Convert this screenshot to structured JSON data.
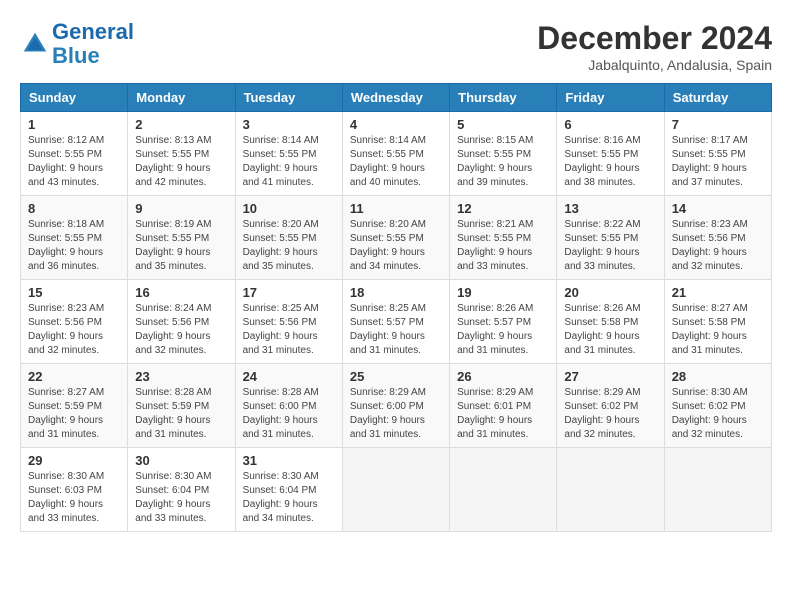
{
  "logo": {
    "line1": "General",
    "line2": "Blue"
  },
  "title": "December 2024",
  "location": "Jabalquinto, Andalusia, Spain",
  "weekdays": [
    "Sunday",
    "Monday",
    "Tuesday",
    "Wednesday",
    "Thursday",
    "Friday",
    "Saturday"
  ],
  "weeks": [
    [
      {
        "day": "1",
        "sunrise": "8:12 AM",
        "sunset": "5:55 PM",
        "daylight": "9 hours and 43 minutes."
      },
      {
        "day": "2",
        "sunrise": "8:13 AM",
        "sunset": "5:55 PM",
        "daylight": "9 hours and 42 minutes."
      },
      {
        "day": "3",
        "sunrise": "8:14 AM",
        "sunset": "5:55 PM",
        "daylight": "9 hours and 41 minutes."
      },
      {
        "day": "4",
        "sunrise": "8:14 AM",
        "sunset": "5:55 PM",
        "daylight": "9 hours and 40 minutes."
      },
      {
        "day": "5",
        "sunrise": "8:15 AM",
        "sunset": "5:55 PM",
        "daylight": "9 hours and 39 minutes."
      },
      {
        "day": "6",
        "sunrise": "8:16 AM",
        "sunset": "5:55 PM",
        "daylight": "9 hours and 38 minutes."
      },
      {
        "day": "7",
        "sunrise": "8:17 AM",
        "sunset": "5:55 PM",
        "daylight": "9 hours and 37 minutes."
      }
    ],
    [
      {
        "day": "8",
        "sunrise": "8:18 AM",
        "sunset": "5:55 PM",
        "daylight": "9 hours and 36 minutes."
      },
      {
        "day": "9",
        "sunrise": "8:19 AM",
        "sunset": "5:55 PM",
        "daylight": "9 hours and 35 minutes."
      },
      {
        "day": "10",
        "sunrise": "8:20 AM",
        "sunset": "5:55 PM",
        "daylight": "9 hours and 35 minutes."
      },
      {
        "day": "11",
        "sunrise": "8:20 AM",
        "sunset": "5:55 PM",
        "daylight": "9 hours and 34 minutes."
      },
      {
        "day": "12",
        "sunrise": "8:21 AM",
        "sunset": "5:55 PM",
        "daylight": "9 hours and 33 minutes."
      },
      {
        "day": "13",
        "sunrise": "8:22 AM",
        "sunset": "5:55 PM",
        "daylight": "9 hours and 33 minutes."
      },
      {
        "day": "14",
        "sunrise": "8:23 AM",
        "sunset": "5:56 PM",
        "daylight": "9 hours and 32 minutes."
      }
    ],
    [
      {
        "day": "15",
        "sunrise": "8:23 AM",
        "sunset": "5:56 PM",
        "daylight": "9 hours and 32 minutes."
      },
      {
        "day": "16",
        "sunrise": "8:24 AM",
        "sunset": "5:56 PM",
        "daylight": "9 hours and 32 minutes."
      },
      {
        "day": "17",
        "sunrise": "8:25 AM",
        "sunset": "5:56 PM",
        "daylight": "9 hours and 31 minutes."
      },
      {
        "day": "18",
        "sunrise": "8:25 AM",
        "sunset": "5:57 PM",
        "daylight": "9 hours and 31 minutes."
      },
      {
        "day": "19",
        "sunrise": "8:26 AM",
        "sunset": "5:57 PM",
        "daylight": "9 hours and 31 minutes."
      },
      {
        "day": "20",
        "sunrise": "8:26 AM",
        "sunset": "5:58 PM",
        "daylight": "9 hours and 31 minutes."
      },
      {
        "day": "21",
        "sunrise": "8:27 AM",
        "sunset": "5:58 PM",
        "daylight": "9 hours and 31 minutes."
      }
    ],
    [
      {
        "day": "22",
        "sunrise": "8:27 AM",
        "sunset": "5:59 PM",
        "daylight": "9 hours and 31 minutes."
      },
      {
        "day": "23",
        "sunrise": "8:28 AM",
        "sunset": "5:59 PM",
        "daylight": "9 hours and 31 minutes."
      },
      {
        "day": "24",
        "sunrise": "8:28 AM",
        "sunset": "6:00 PM",
        "daylight": "9 hours and 31 minutes."
      },
      {
        "day": "25",
        "sunrise": "8:29 AM",
        "sunset": "6:00 PM",
        "daylight": "9 hours and 31 minutes."
      },
      {
        "day": "26",
        "sunrise": "8:29 AM",
        "sunset": "6:01 PM",
        "daylight": "9 hours and 31 minutes."
      },
      {
        "day": "27",
        "sunrise": "8:29 AM",
        "sunset": "6:02 PM",
        "daylight": "9 hours and 32 minutes."
      },
      {
        "day": "28",
        "sunrise": "8:30 AM",
        "sunset": "6:02 PM",
        "daylight": "9 hours and 32 minutes."
      }
    ],
    [
      {
        "day": "29",
        "sunrise": "8:30 AM",
        "sunset": "6:03 PM",
        "daylight": "9 hours and 33 minutes."
      },
      {
        "day": "30",
        "sunrise": "8:30 AM",
        "sunset": "6:04 PM",
        "daylight": "9 hours and 33 minutes."
      },
      {
        "day": "31",
        "sunrise": "8:30 AM",
        "sunset": "6:04 PM",
        "daylight": "9 hours and 34 minutes."
      },
      null,
      null,
      null,
      null
    ]
  ],
  "labels": {
    "sunrise": "Sunrise:",
    "sunset": "Sunset:",
    "daylight": "Daylight:"
  }
}
